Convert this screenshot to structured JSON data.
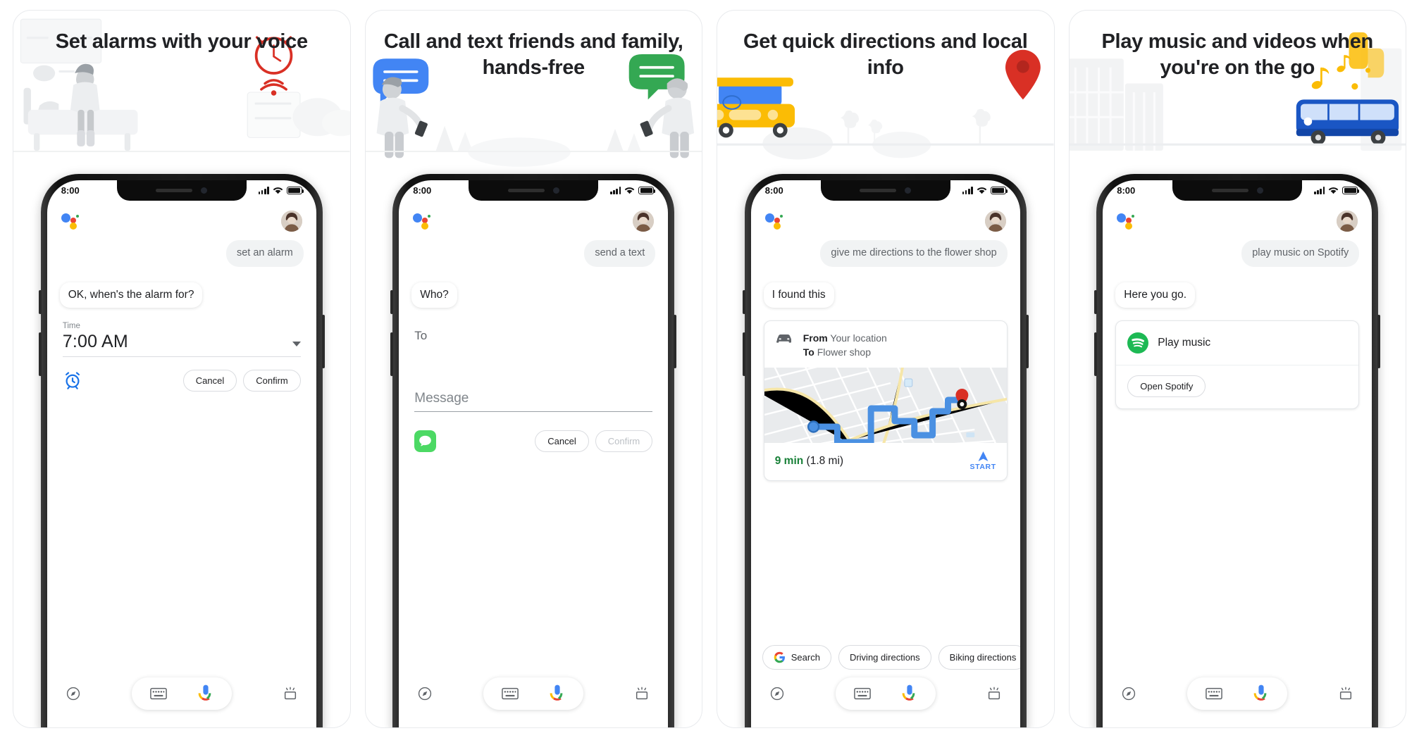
{
  "panels": [
    {
      "id": "alarms",
      "title": "Set alarms with your voice",
      "hero_art": "bedroom-alarm-clock-illustration",
      "status": {
        "time": "8:00",
        "signal": "signal-bars-icon",
        "wifi": "wifi-icon",
        "battery": "battery-full-icon"
      },
      "assistant_logo": "google-assistant-logo",
      "avatar": "user-avatar",
      "user_query": "set an alarm",
      "assistant_reply": "OK, when's the alarm for?",
      "alarm": {
        "field_label": "Time",
        "value": "7:00 AM",
        "dropdown_icon": "chevron-down-icon",
        "app_icon": "alarm-clock-icon",
        "cancel": "Cancel",
        "confirm": "Confirm"
      },
      "nav": {
        "explore": "compass-icon",
        "keyboard": "keyboard-icon",
        "mic": "microphone-icon",
        "lens": "google-lens-icon"
      }
    },
    {
      "id": "messaging",
      "title": "Call and text friends and family, hands-free",
      "hero_art": "two-people-texting-illustration",
      "status": {
        "time": "8:00",
        "signal": "signal-bars-icon",
        "wifi": "wifi-icon",
        "battery": "battery-full-icon"
      },
      "assistant_logo": "google-assistant-logo",
      "avatar": "user-avatar",
      "user_query": "send a text",
      "assistant_reply": "Who?",
      "composer": {
        "to_placeholder": "To",
        "message_placeholder": "Message",
        "app_icon": "messages-app-icon",
        "cancel": "Cancel",
        "confirm": "Confirm"
      },
      "nav": {
        "explore": "compass-icon",
        "keyboard": "keyboard-icon",
        "mic": "microphone-icon",
        "lens": "google-lens-icon"
      }
    },
    {
      "id": "directions",
      "title": "Get quick directions and local info",
      "hero_art": "car-and-map-pin-illustration",
      "status": {
        "time": "8:00",
        "signal": "signal-bars-icon",
        "wifi": "wifi-icon",
        "battery": "battery-full-icon"
      },
      "assistant_logo": "google-assistant-logo",
      "avatar": "user-avatar",
      "user_query": "give me directions to the flower shop",
      "assistant_reply": "I found this",
      "directions_card": {
        "mode_icon": "car-icon",
        "from_label": "From",
        "from_value": "Your location",
        "to_label": "To",
        "to_value": "Flower shop",
        "map_icon": "route-map",
        "duration": "9 min",
        "distance": "(1.8 mi)",
        "start_icon": "navigation-arrow-icon",
        "start_label": "START"
      },
      "chips": [
        {
          "icon": "google-g-icon",
          "label": "Search"
        },
        {
          "icon": "",
          "label": "Driving directions"
        },
        {
          "icon": "",
          "label": "Biking directions"
        }
      ],
      "nav": {
        "explore": "compass-icon",
        "keyboard": "keyboard-icon",
        "mic": "microphone-icon",
        "lens": "google-lens-icon"
      }
    },
    {
      "id": "music",
      "title": "Play music and videos when you're on the go",
      "hero_art": "bus-with-music-notes-illustration",
      "status": {
        "time": "8:00",
        "signal": "signal-bars-icon",
        "wifi": "wifi-icon",
        "battery": "battery-full-icon"
      },
      "assistant_logo": "google-assistant-logo",
      "avatar": "user-avatar",
      "user_query": "play music on Spotify",
      "assistant_reply": "Here you go.",
      "music_card": {
        "service_icon": "spotify-icon",
        "action": "Play music",
        "open_button": "Open Spotify"
      },
      "nav": {
        "explore": "compass-icon",
        "keyboard": "keyboard-icon",
        "mic": "microphone-icon",
        "lens": "google-lens-icon"
      }
    }
  ],
  "colors": {
    "google_blue": "#4285F4",
    "google_red": "#EA4335",
    "google_yellow": "#FBBC05",
    "google_green": "#34A853",
    "spotify_green": "#1DB954",
    "messages_green": "#4CD964",
    "map_route_blue": "#4A90E2",
    "eta_green": "#188038",
    "text_primary": "#202124",
    "text_secondary": "#5f6368",
    "bubble_gray": "#f1f3f4"
  }
}
